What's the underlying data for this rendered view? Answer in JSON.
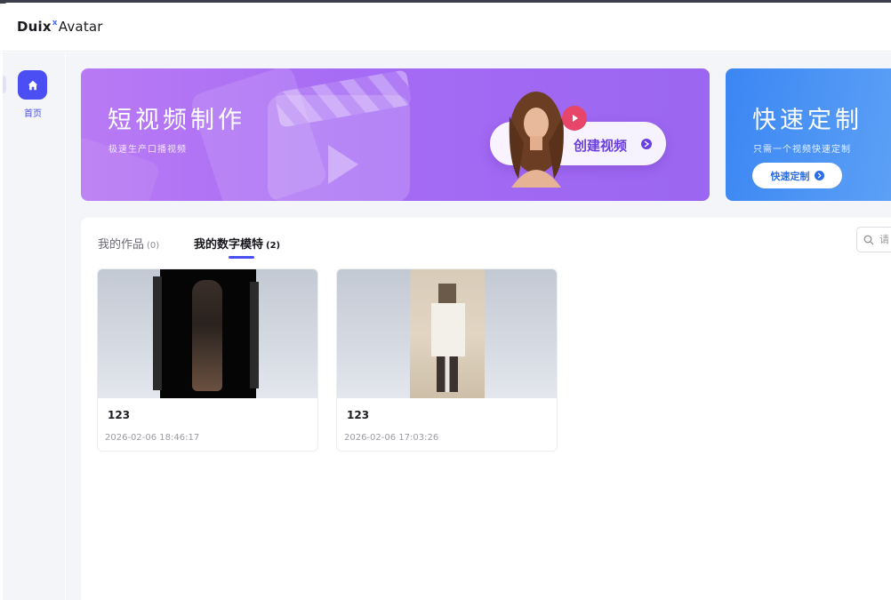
{
  "app": {
    "brand_main": "Duix",
    "brand_x": "x",
    "brand_suffix": "Avatar"
  },
  "sidebar": {
    "items": [
      {
        "label": "首页",
        "icon": "home-icon",
        "active": true
      }
    ]
  },
  "banners": [
    {
      "title": "短视频制作",
      "subtitle": "极速生产口播视频",
      "cta": "创建视频",
      "color": "#a56bf4"
    },
    {
      "title": "快速定制",
      "subtitle": "只需一个视频快速定制",
      "cta": "快速定制",
      "color": "#3b86f3"
    }
  ],
  "tabs": [
    {
      "label": "我的作品",
      "count": "(0)",
      "active": false
    },
    {
      "label": "我的数字模特",
      "count": "(2)",
      "active": true
    }
  ],
  "search": {
    "placeholder": "请"
  },
  "cards": [
    {
      "title": "123",
      "date": "2026-02-06 18:46:17"
    },
    {
      "title": "123",
      "date": "2026-02-06 17:03:26"
    }
  ],
  "colors": {
    "accent": "#4b4ef2",
    "banner_purple": "#a56bf4",
    "banner_blue": "#3b86f3"
  }
}
